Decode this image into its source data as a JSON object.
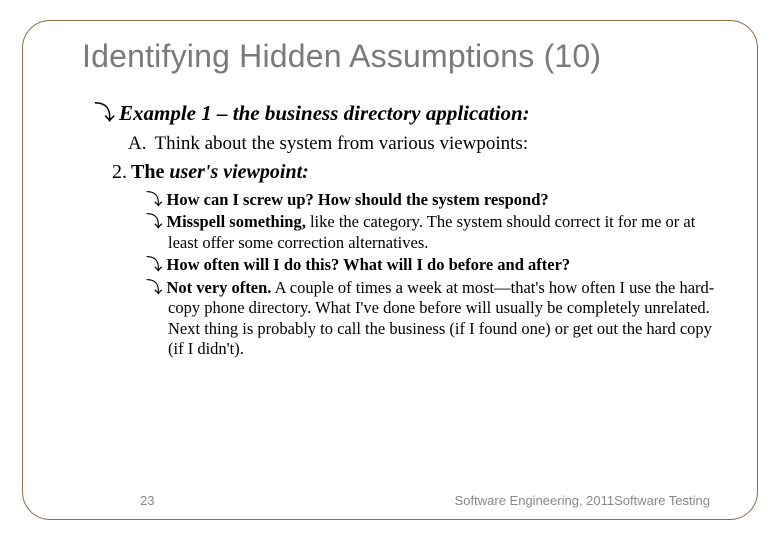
{
  "title": "Identifying Hidden Assumptions (10)",
  "lvl1": {
    "bullet": "⤵",
    "lead": "Example 1",
    "rest": " – the business directory application:"
  },
  "lvl2": {
    "letter": "A.",
    "text": "Think about the system from various viewpoints:"
  },
  "lvl3": {
    "num": "2.",
    "lead": "The ",
    "ital": "user's viewpoint:"
  },
  "items": [
    {
      "bullet": "⤵",
      "bold": "How can I screw up? How should the system respond?",
      "rest": ""
    },
    {
      "bullet": "⤵",
      "bold": "Misspell something,",
      "rest": " like the category. The system should correct it for me or at least offer some correction alternatives."
    },
    {
      "bullet": "⤵",
      "bold": "How often will I do this? What will I do before and after?",
      "rest": ""
    },
    {
      "bullet": "⤵",
      "bold": "Not very often.",
      "rest": " A couple of times a week at most—that's how often I use the hard-copy phone directory. What I've done before will usually be completely unrelated. Next thing is probably to call the business (if I found one) or get out the hard copy (if I didn't)."
    }
  ],
  "footer": {
    "page": "23",
    "right": "Software Engineering,   2011Software  Testing"
  }
}
